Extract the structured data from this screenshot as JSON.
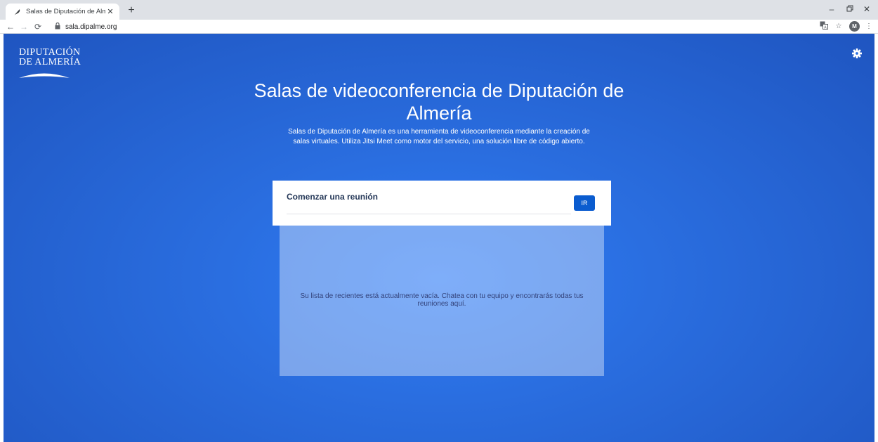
{
  "browser": {
    "tab_title": "Salas de Diputación de Almería",
    "url": "sala.dipalme.org",
    "profile_initial": "M"
  },
  "icons": {
    "tab_favicon": "feather-icon",
    "tab_close": "close-icon",
    "new_tab": "plus-icon",
    "back": "arrow-left-icon",
    "forward": "arrow-right-icon",
    "reload": "reload-icon",
    "lock": "lock-icon",
    "translate": "translate-icon",
    "bookmark": "star-icon",
    "menu": "kebab-menu-icon",
    "minimize": "minimize-icon",
    "restore": "restore-icon",
    "window_close": "close-icon",
    "settings": "gear-icon"
  },
  "page": {
    "logo": {
      "line1": "DIPUTACIÓN",
      "line2": "DE ALMERÍA"
    },
    "title": "Salas de videoconferencia de Diputación de Almería",
    "description": "Salas de Diputación de Almería es una herramienta de videoconferencia mediante la creación de salas virtuales. Utiliza Jitsi Meet como motor del servicio, una solución libre de código abierto.",
    "start_meeting": {
      "label": "Comenzar una reunión",
      "input_value": "",
      "go_label": "IR"
    },
    "recent": {
      "empty_message": "Su lista de recientes está actualmente vacía. Chatea con tu equipo y encontrarás todas tus reuniones aquí."
    }
  },
  "colors": {
    "page_background": "#2a6ee0",
    "go_button": "#0b5ccf",
    "tabstrip": "#dee1e6"
  }
}
